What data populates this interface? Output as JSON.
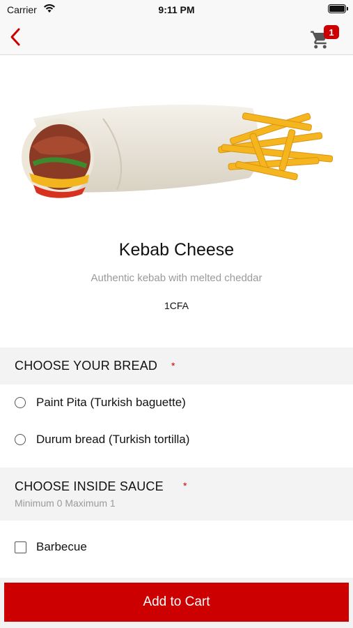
{
  "status_bar": {
    "carrier": "Carrier",
    "time": "9:11 PM"
  },
  "navbar": {
    "back_icon": "chevron-left-icon",
    "cart_icon": "cart-icon",
    "cart_count": "1"
  },
  "product": {
    "title": "Kebab Cheese",
    "description": "Authentic kebab with melted cheddar",
    "price": "1CFA"
  },
  "sections": {
    "bread": {
      "title": "CHOOSE YOUR BREAD",
      "required_mark": "*",
      "options": [
        {
          "label": "Paint Pita (Turkish baguette)"
        },
        {
          "label": "Durum bread (Turkish tortilla)"
        }
      ]
    },
    "sauce": {
      "title": "CHOOSE INSIDE SAUCE",
      "required_mark": "*",
      "note": "Minimum 0 Maximum 1",
      "options": [
        {
          "label": "Barbecue"
        }
      ]
    }
  },
  "add_to_cart": {
    "label": "Add to Cart"
  },
  "colors": {
    "accent": "#cc0000",
    "section_bg": "#f3f3f3",
    "muted_text": "#9a9a9a"
  }
}
